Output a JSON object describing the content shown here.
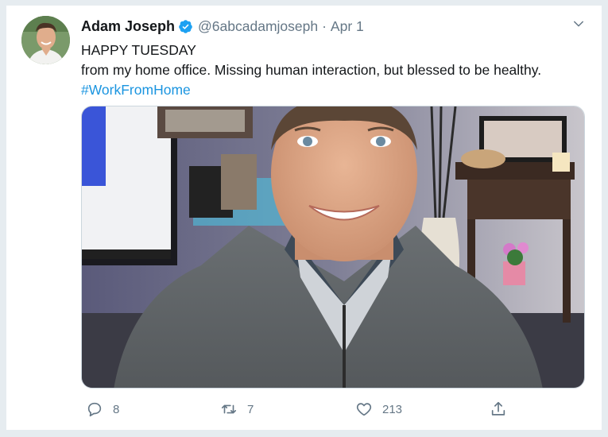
{
  "tweet": {
    "author_name": "Adam Joseph",
    "handle": "@6abcadamjoseph",
    "separator": "·",
    "date": "Apr 1",
    "text_line1": "HAPPY TUESDAY",
    "text_line2": "from my home office. Missing human interaction, but blessed to be healthy.",
    "hashtag": "#WorkFromHome",
    "verified": true
  },
  "actions": {
    "reply_count": "8",
    "retweet_count": "7",
    "like_count": "213",
    "share_count": ""
  },
  "icons": {
    "verified": "verified-badge-icon",
    "more": "chevron-down-icon",
    "reply": "reply-icon",
    "retweet": "retweet-icon",
    "like": "heart-icon",
    "share": "share-icon"
  },
  "colors": {
    "accent": "#1da1f2",
    "link": "#1b95e0",
    "secondary_text": "#657786",
    "page_background": "#e6ecf0"
  }
}
